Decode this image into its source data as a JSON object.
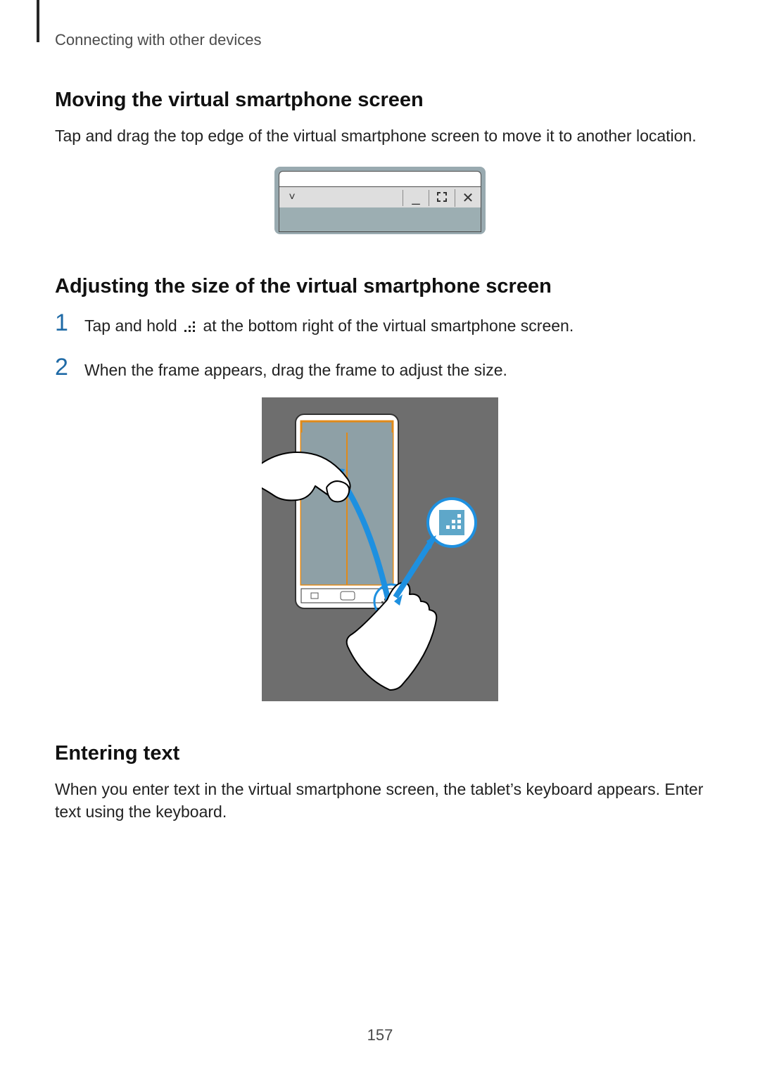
{
  "header": {
    "running_head": "Connecting with other devices"
  },
  "section1": {
    "title": "Moving the virtual smartphone screen",
    "body": "Tap and drag the top edge of the virtual smartphone screen to move it to another location."
  },
  "section2": {
    "title": "Adjusting the size of the virtual smartphone screen",
    "steps": [
      {
        "num": "1",
        "before": "Tap and hold ",
        "after": " at the bottom right of the virtual smartphone screen."
      },
      {
        "num": "2",
        "text": "When the frame appears, drag the frame to adjust the size."
      }
    ]
  },
  "section3": {
    "title": "Entering text",
    "body": "When you enter text in the virtual smartphone screen, the tablet’s keyboard appears. Enter text using the keyboard."
  },
  "footer": {
    "page_number": "157"
  }
}
